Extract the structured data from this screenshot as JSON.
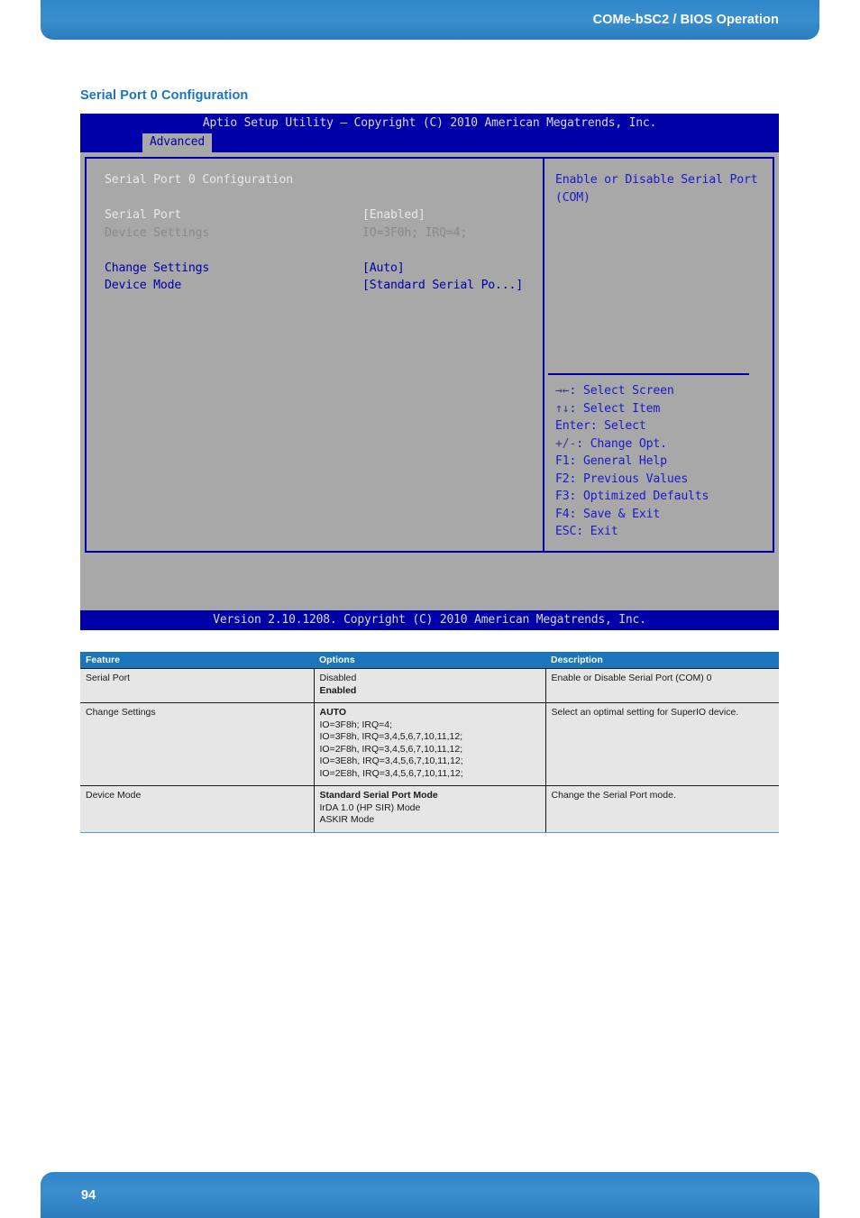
{
  "page_header": {
    "title": "COMe-bSC2 / BIOS Operation"
  },
  "section": {
    "title": "Serial Port 0 Configuration"
  },
  "bios": {
    "title_bar": "Aptio Setup Utility – Copyright (C) 2010 American Megatrends, Inc.",
    "active_tab": "Advanced",
    "panel_heading": "Serial Port 0 Configuration",
    "items": [
      {
        "label": "Serial Port",
        "value": "[Enabled]"
      },
      {
        "label": "Device Settings",
        "value": "IO=3F0h; IRQ=4;"
      },
      {
        "label": "Change Settings",
        "value": "[Auto]"
      },
      {
        "label": "Device Mode",
        "value": "[Standard Serial Po...]"
      }
    ],
    "help": {
      "line1": "Enable or Disable Serial Port",
      "line2": "(COM)"
    },
    "keys": [
      {
        "glyph": "→←",
        "text": ": Select Screen"
      },
      {
        "glyph": "↑↓",
        "text": ": Select Item"
      },
      {
        "glyph": "Enter",
        "text": ": Select"
      },
      {
        "glyph": "+/-",
        "text": ": Change Opt."
      },
      {
        "glyph": "F1",
        "text": ": General Help"
      },
      {
        "glyph": "F2",
        "text": ": Previous Values"
      },
      {
        "glyph": "F3",
        "text": ": Optimized Defaults"
      },
      {
        "glyph": "F4",
        "text": ": Save & Exit"
      },
      {
        "glyph": "ESC",
        "text": ": Exit"
      }
    ],
    "footer_bar": "Version 2.10.1208. Copyright (C) 2010 American Megatrends, Inc."
  },
  "table": {
    "headers": {
      "feature": "Feature",
      "options": "Options",
      "description": "Description"
    },
    "rows": [
      {
        "feature": "Serial Port",
        "options": [
          "Disabled",
          "Enabled"
        ],
        "default_index": 1,
        "description": "Enable or Disable Serial Port (COM) 0"
      },
      {
        "feature": "Change Settings",
        "options": [
          "AUTO",
          "IO=3F8h; IRQ=4;",
          "IO=3F8h, IRQ=3,4,5,6,7,10,11,12;",
          "IO=2F8h, IRQ=3,4,5,6,7,10,11,12;",
          "IO=3E8h, IRQ=3,4,5,6,7,10,11,12;",
          "IO=2E8h, IRQ=3,4,5,6,7,10,11,12;"
        ],
        "default_index": 0,
        "description": "Select an optimal setting for SuperIO device."
      },
      {
        "feature": "Device Mode",
        "options": [
          "Standard Serial Port Mode",
          "IrDA 1.0 (HP SIR) Mode",
          "ASKIR Mode"
        ],
        "default_index": 0,
        "description": "Change the Serial Port mode."
      }
    ]
  },
  "page_footer": {
    "page_number": "94"
  },
  "colors": {
    "brand_blue": "#1b75bb",
    "header_band": "#2f86c9",
    "bios_blue": "#0000a8",
    "bios_grey": "#a8a8a8",
    "table_row": "#e6e6e6"
  }
}
